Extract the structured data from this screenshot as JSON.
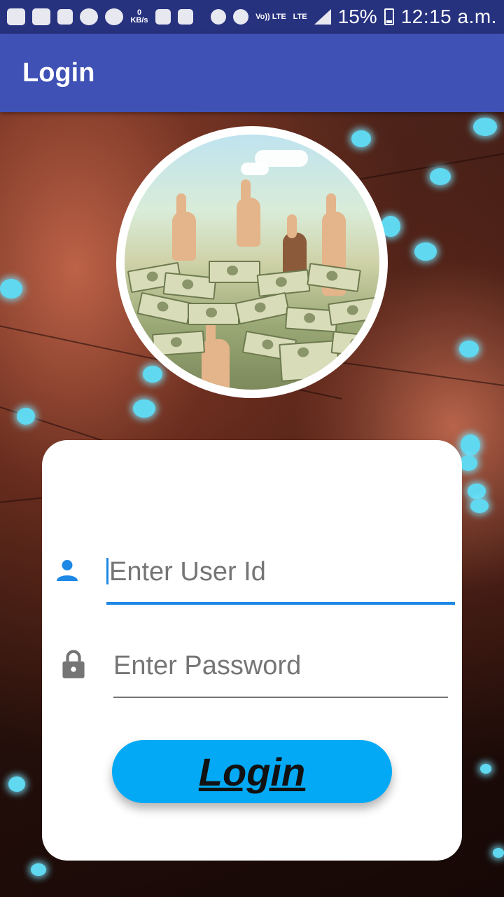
{
  "status_bar": {
    "kbs_value": "0",
    "kbs_unit": "KB/s",
    "volte_label": "Vo)) LTE",
    "lte_label": "LTE",
    "battery": "15%",
    "time": "12:15 a.m."
  },
  "app_bar": {
    "title": "Login"
  },
  "form": {
    "user_id_placeholder": "Enter User Id",
    "password_placeholder": "Enter Password",
    "login_button_label": "Login"
  },
  "colors": {
    "status_bar": "#27327f",
    "app_bar": "#3f51b5",
    "accent": "#1e88e5",
    "button": "#03a9f4"
  },
  "icons": {
    "user": "person-icon",
    "password": "lock-icon"
  }
}
